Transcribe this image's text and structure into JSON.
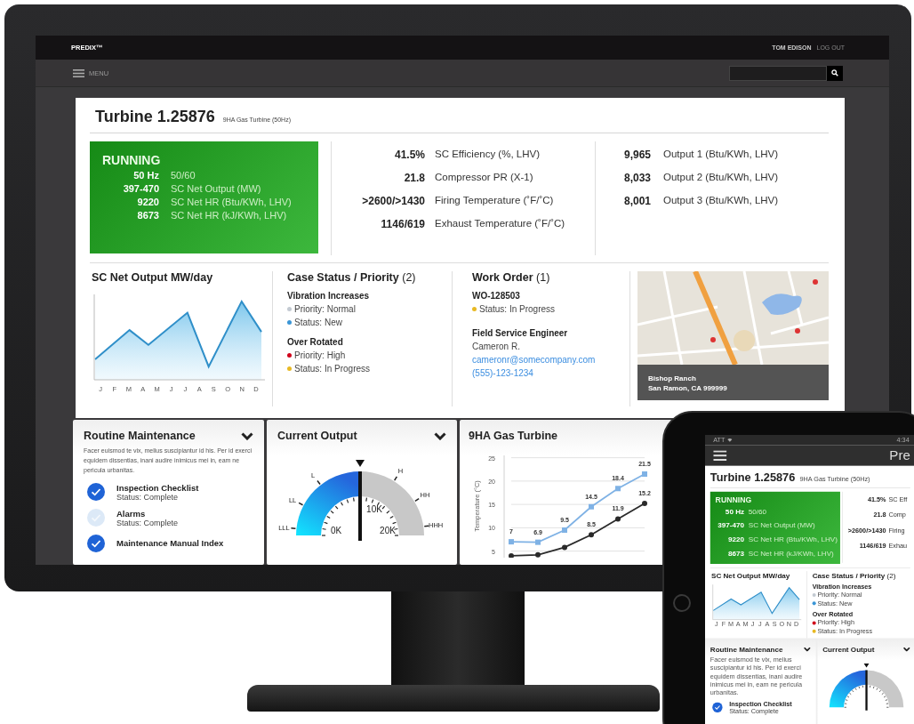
{
  "top_bar": {
    "brand": "PREDIX™",
    "user": "TOM EDISON",
    "logout": "LOG OUT"
  },
  "menu_bar": {
    "menu_label": "MENU"
  },
  "turbine": {
    "title": "Turbine 1.25876",
    "subtitle": "9HA Gas Turbine (50Hz)",
    "status": {
      "label": "RUNNING",
      "kind": "running",
      "rows": [
        {
          "value": "50 Hz",
          "label": "50/60"
        },
        {
          "value": "397-470",
          "label": "SC Net Output (MW)"
        },
        {
          "value": "9220",
          "label": "SC Net HR (Btu/KWh, LHV)"
        },
        {
          "value": "8673",
          "label": "SC Net HR (kJ/KWh, LHV)"
        }
      ]
    },
    "metrics": [
      {
        "value": "41.5%",
        "label": "SC Efficiency (%, LHV)"
      },
      {
        "value": "21.8",
        "label": "Compressor PR (X-1)"
      },
      {
        "value": ">2600/>1430",
        "label": "Firing Temperature (˚F/˚C)"
      },
      {
        "value": "1146/619",
        "label": "Exhaust Temperature (˚F/˚C)"
      }
    ],
    "outputs": [
      {
        "value": "9,965",
        "label": "Output 1 (Btu/KWh, LHV)"
      },
      {
        "value": "8,033",
        "label": "Output 2 (Btu/KWh, LHV)"
      },
      {
        "value": "8,001",
        "label": "Output 3 (Btu/KWh, LHV)"
      }
    ]
  },
  "net_output_chart": {
    "title": "SC Net Output MW/day",
    "months": [
      "J",
      "F",
      "M",
      "A",
      "M",
      "J",
      "J",
      "A",
      "S",
      "O",
      "N",
      "D"
    ]
  },
  "case_status": {
    "title": "**Case Status / Priority** (2)",
    "cases": [
      {
        "name": "Vibration Increases",
        "items": [
          {
            "text": "Priority: Normal",
            "color": "#c3cad2"
          },
          {
            "text": "Status: New",
            "color": "#3b96d6"
          }
        ]
      },
      {
        "name": "Over Rotated",
        "items": [
          {
            "text": "Priority: High",
            "color": "#d0021b"
          },
          {
            "text": "Status: In Progress",
            "color": "#e8b923"
          }
        ]
      }
    ]
  },
  "work_order": {
    "title": "**Work Order** (1)",
    "order_id": "WO-128503",
    "status": {
      "text": "Status: In Progress",
      "color": "#e8b923"
    },
    "engineer_heading": "Field Service Engineer",
    "engineer_name": "Cameron R.",
    "email": "cameronr@somecompany.com",
    "phone": "(555)-123-1234"
  },
  "map": {
    "place": "Bishop Ranch",
    "address": "San Ramon, CA 999999"
  },
  "maintenance": {
    "title": "Routine Maintenance",
    "description": "Facer euismod te vix, melius suscipiantur id his. Per id exerci equidem dissentias, inani audire inimicus mei in, eam ne pericula urbanitas.",
    "items": [
      {
        "name": "Inspection Checklist",
        "status": "Status: Complete",
        "checked": true
      },
      {
        "name": "Alarms",
        "status": "Status: Complete",
        "checked": false
      },
      {
        "name": "Maintenance Manual Index",
        "checked": true
      }
    ]
  },
  "current_output": {
    "title": "Current Output",
    "level": 0.5,
    "zone_labels": [
      "LLL",
      "LL",
      "L",
      "H",
      "HH",
      "HHH"
    ],
    "scale_labels": [
      "0K",
      "10K",
      "20K"
    ]
  },
  "gas_turbine_chart": {
    "title": "9HA Gas Turbine",
    "chart_data": {
      "type": "line",
      "ylabel": "Temperature (°C)",
      "ylim": [
        3.5,
        25.5
      ],
      "yticks": [
        5,
        10,
        15,
        20,
        25
      ],
      "grid": true,
      "series": [
        {
          "color": "#7fb2e5",
          "marker": "square",
          "values": [
            7,
            6.9,
            9.5,
            14.5,
            18.4,
            21.5
          ]
        },
        {
          "color": "#2a2a2a",
          "marker": "circle",
          "values": [
            4,
            4.2,
            5.8,
            8.5,
            11.9,
            15.2
          ]
        }
      ],
      "value_labels": [
        [
          "7",
          "6.9",
          "9.5",
          "14.5",
          "18.4",
          "21.5"
        ],
        [
          null,
          null,
          null,
          "8.5",
          "11.9",
          "15.2"
        ]
      ]
    }
  },
  "tablet": {
    "carrier": "ATT",
    "time": "4:34",
    "app_title": "Pre",
    "turbine": {
      "title": "Turbine 1.25876",
      "subtitle": "9HA Gas Turbine (50Hz)",
      "status": {
        "label": "RUNNING",
        "kind": "running",
        "rows": [
          {
            "value": "50 Hz",
            "label": "50/60"
          },
          {
            "value": "397-470",
            "label": "SC Net Output (MW)"
          },
          {
            "value": "9220",
            "label": "SC Net HR (Btu/KWh, LHV)"
          },
          {
            "value": "8673",
            "label": "SC Net HR (kJ/KWh, LHV)"
          }
        ]
      },
      "metrics": [
        {
          "value": "41.5%",
          "label": "SC Eff"
        },
        {
          "value": "21.8",
          "label": "Comp"
        },
        {
          "value": ">2600/>1430",
          "label": "Firing"
        },
        {
          "value": "1146/619",
          "label": "Exhau"
        }
      ]
    },
    "net_output_chart": {
      "title": "SC Net Output MW/day",
      "months": [
        "J",
        "F",
        "M",
        "A",
        "M",
        "J",
        "J",
        "A",
        "S",
        "O",
        "N",
        "D"
      ]
    },
    "case_status": {
      "title": "**Case Status / Priority** (2)",
      "cases": [
        {
          "name": "Vibration Increases",
          "items": [
            {
              "text": "Priority: Normal",
              "color": "#c3cad2"
            },
            {
              "text": "Status: New",
              "color": "#3b96d6"
            }
          ]
        },
        {
          "name": "Over Rotated",
          "items": [
            {
              "text": "Priority: High",
              "color": "#d0021b"
            },
            {
              "text": "Status: In Progress",
              "color": "#e8b923"
            }
          ]
        }
      ]
    },
    "maintenance": {
      "title": "Routine Maintenance",
      "description": "Facer euismod te vix, melius suscipiantur id his. Per id exerci equidem dissentias, inani audire inimicus mei in, eam ne pericula urbanitas.",
      "items": [
        {
          "name": "Inspection Checklist",
          "status": "Status: Complete",
          "checked": true
        }
      ]
    },
    "current_output": {
      "title": "Current Output",
      "level": 0.5
    }
  }
}
